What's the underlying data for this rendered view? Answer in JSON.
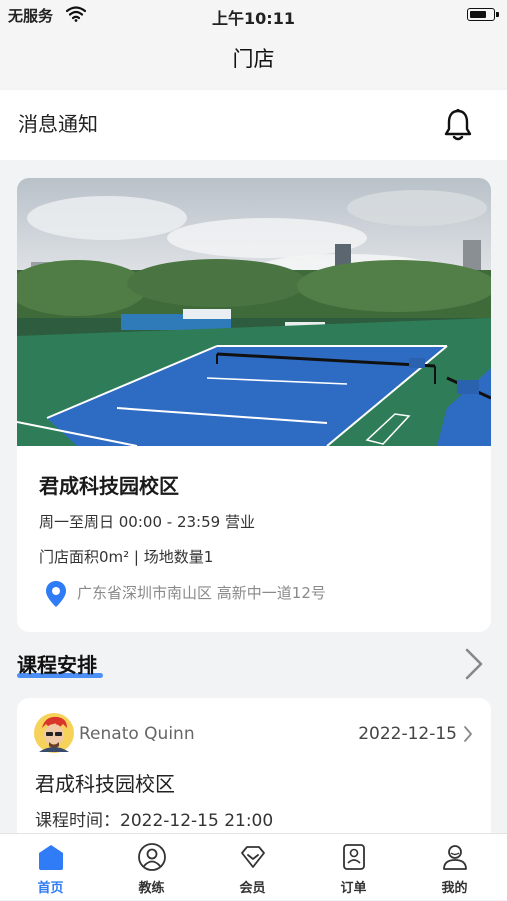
{
  "status_bar": {
    "carrier": "无服务",
    "time": "上午10:11"
  },
  "navbar": {
    "title": "门店"
  },
  "notice": {
    "label": "消息通知",
    "icon": "bell-icon"
  },
  "store": {
    "name": "君成科技园校区",
    "hours": "周一至周日 00:00 - 23:59 营业",
    "area": "门店面积0m² | 场地数量1",
    "address": "广东省深圳市南山区 高新中一道12号"
  },
  "schedule": {
    "title": "课程安排",
    "course": {
      "coach": "Renato Quinn",
      "date": "2022-12-15",
      "name": "君成科技园校区",
      "time": "课程时间：2022-12-15 21:00"
    }
  },
  "tabbar": {
    "items": [
      {
        "label": "首页",
        "icon": "home-icon",
        "active": true
      },
      {
        "label": "教练",
        "icon": "coach-icon",
        "active": false
      },
      {
        "label": "会员",
        "icon": "member-icon",
        "active": false
      },
      {
        "label": "订单",
        "icon": "order-icon",
        "active": false
      },
      {
        "label": "我的",
        "icon": "profile-icon",
        "active": false
      }
    ]
  },
  "colors": {
    "accent": "#2f7cf6",
    "background": "#f2f3f5"
  }
}
